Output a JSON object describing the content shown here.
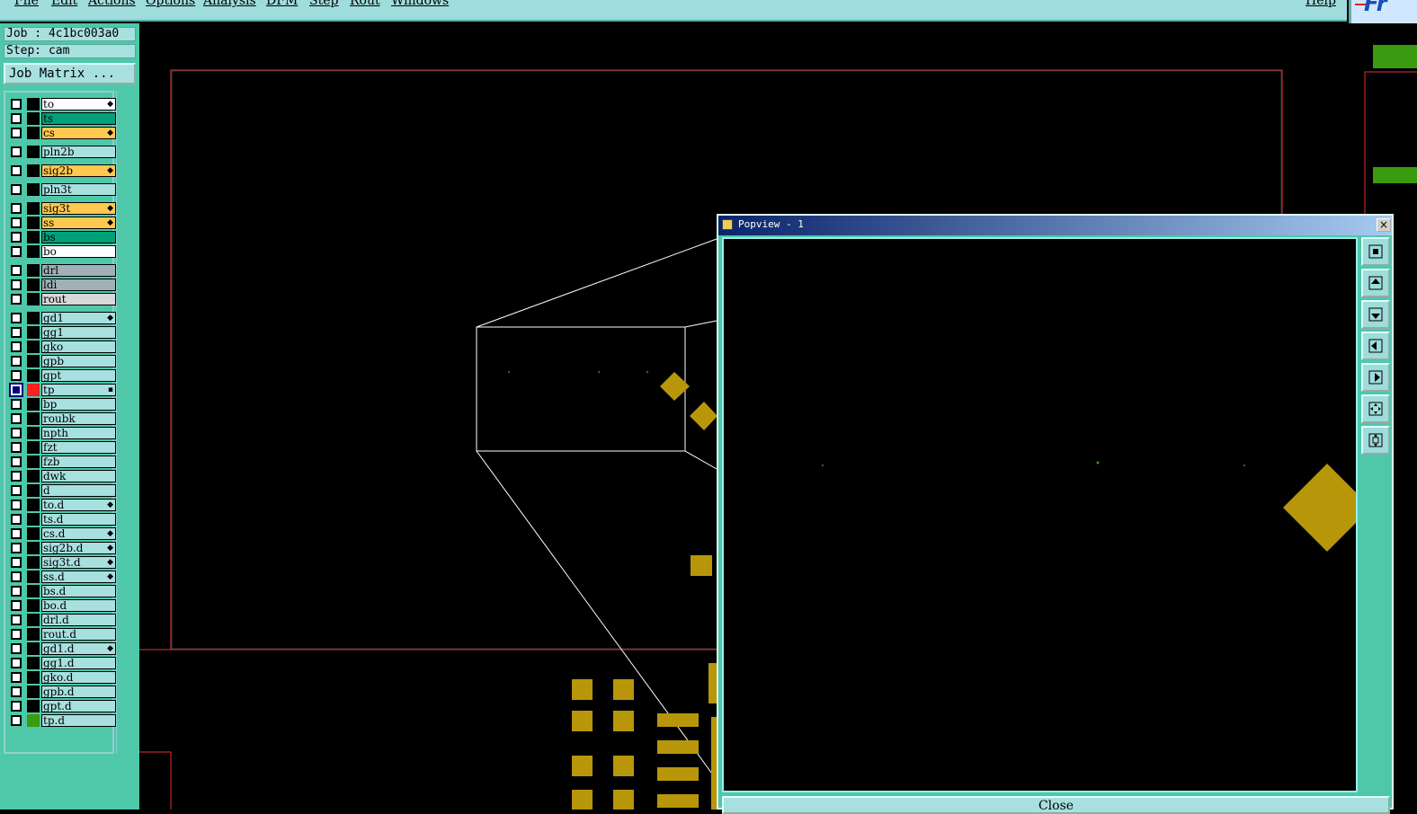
{
  "menubar": {
    "items": [
      "File",
      "Edit",
      "Actions",
      "Options",
      "Analysis",
      "DFM",
      "Step",
      "Rout",
      "Windows"
    ],
    "help": "Help",
    "logo_text": "Fr"
  },
  "left_panel": {
    "job_label": "Job : 4c1bc003a0",
    "step_label": "Step: cam",
    "job_matrix_button": "Job Matrix ..."
  },
  "layers": [
    {
      "name": "to",
      "color": "#ffffff",
      "mark": true
    },
    {
      "name": "ts",
      "color": "#00a07a",
      "mark": false
    },
    {
      "name": "cs",
      "color": "#ffc850",
      "mark": true
    },
    {
      "name": "pln2b",
      "color": "#a8e0e0",
      "mark": false
    },
    {
      "name": "sig2b",
      "color": "#ffc850",
      "mark": true
    },
    {
      "name": "pln3t",
      "color": "#a8e0e0",
      "mark": false
    },
    {
      "name": "sig3t",
      "color": "#ffc850",
      "mark": true
    },
    {
      "name": "ss",
      "color": "#ffc850",
      "mark": true
    },
    {
      "name": "bs",
      "color": "#00a07a",
      "mark": false
    },
    {
      "name": "bo",
      "color": "#ffffff",
      "mark": false
    },
    {
      "name": "drl",
      "color": "#a0b0b8",
      "mark": false
    },
    {
      "name": "ldi",
      "color": "#a0b0b8",
      "mark": false
    },
    {
      "name": "rout",
      "color": "#d8d8d8",
      "mark": false
    },
    {
      "name": "gd1",
      "color": "#a8e0e0",
      "mark": true
    },
    {
      "name": "gg1",
      "color": "#a8e0e0",
      "mark": false
    },
    {
      "name": "gko",
      "color": "#a8e0e0",
      "mark": false
    },
    {
      "name": "gpb",
      "color": "#a8e0e0",
      "mark": false
    },
    {
      "name": "gpt",
      "color": "#a8e0e0",
      "mark": false
    },
    {
      "name": "tp",
      "color": "#a8e0e0",
      "mark": false,
      "active": true
    },
    {
      "name": "bp",
      "color": "#a8e0e0",
      "mark": false
    },
    {
      "name": "roubk",
      "color": "#a8e0e0",
      "mark": false
    },
    {
      "name": "npth",
      "color": "#a8e0e0",
      "mark": false
    },
    {
      "name": "fzt",
      "color": "#a8e0e0",
      "mark": false
    },
    {
      "name": "fzb",
      "color": "#a8e0e0",
      "mark": false
    },
    {
      "name": "dwk",
      "color": "#a8e0e0",
      "mark": false
    },
    {
      "name": "d",
      "color": "#a8e0e0",
      "mark": false
    },
    {
      "name": "to.d",
      "color": "#a8e0e0",
      "mark": true
    },
    {
      "name": "ts.d",
      "color": "#a8e0e0",
      "mark": false
    },
    {
      "name": "cs.d",
      "color": "#a8e0e0",
      "mark": true
    },
    {
      "name": "sig2b.d",
      "color": "#a8e0e0",
      "mark": true
    },
    {
      "name": "sig3t.d",
      "color": "#a8e0e0",
      "mark": true
    },
    {
      "name": "ss.d",
      "color": "#a8e0e0",
      "mark": true
    },
    {
      "name": "bs.d",
      "color": "#a8e0e0",
      "mark": false
    },
    {
      "name": "bo.d",
      "color": "#a8e0e0",
      "mark": false
    },
    {
      "name": "drl.d",
      "color": "#a8e0e0",
      "mark": false
    },
    {
      "name": "rout.d",
      "color": "#a8e0e0",
      "mark": false
    },
    {
      "name": "gd1.d",
      "color": "#a8e0e0",
      "mark": true
    },
    {
      "name": "gg1.d",
      "color": "#a8e0e0",
      "mark": false
    },
    {
      "name": "gko.d",
      "color": "#a8e0e0",
      "mark": false
    },
    {
      "name": "gpb.d",
      "color": "#a8e0e0",
      "mark": false
    },
    {
      "name": "gpt.d",
      "color": "#a8e0e0",
      "mark": false
    },
    {
      "name": "tp.d",
      "color": "#a8e0e0",
      "mark": false,
      "swatch": "#3a9a10"
    }
  ],
  "colors": {
    "panel": "#4ec8a8",
    "menubar": "#9fdcdc",
    "pad_gold": "#b8960a",
    "profile_red": "#e03030",
    "green_feature": "#3a9a10"
  },
  "popview": {
    "title": "Popview - 1",
    "close_glyph": "×",
    "close_button": "Close",
    "tools": [
      "zoom-in-icon",
      "pan-up-icon",
      "pan-down-icon",
      "pan-left-icon",
      "pan-right-icon",
      "fit-icon",
      "zoom-home-icon"
    ]
  }
}
